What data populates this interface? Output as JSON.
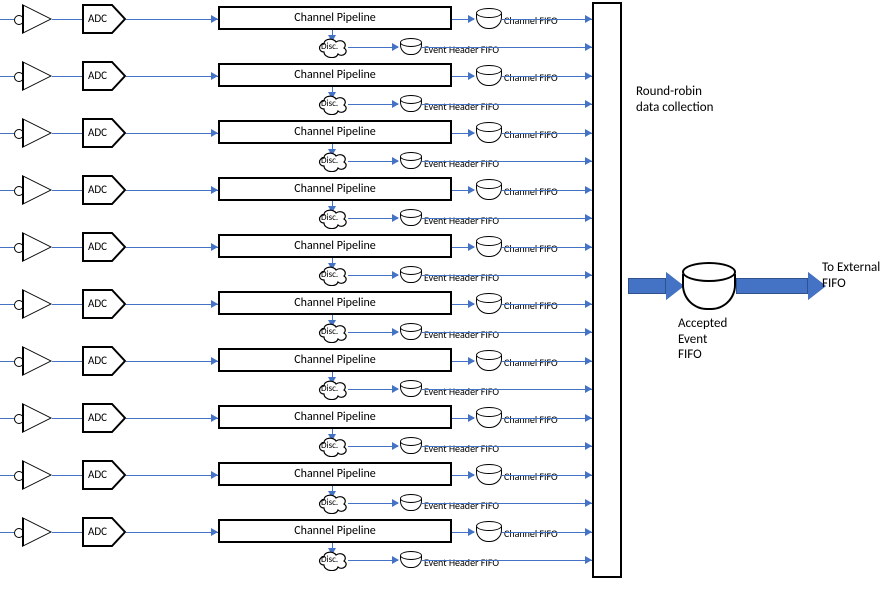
{
  "channels": [
    {
      "adc": "ADC",
      "pipeline": "Channel Pipeline",
      "channel_fifo": "Channel FIFO",
      "disc": "Disc.",
      "event_header_fifo": "Event Header FIFO"
    },
    {
      "adc": "ADC",
      "pipeline": "Channel Pipeline",
      "channel_fifo": "Channel FIFO",
      "disc": "Disc.",
      "event_header_fifo": "Event Header FIFO"
    },
    {
      "adc": "ADC",
      "pipeline": "Channel Pipeline",
      "channel_fifo": "Channel FIFO",
      "disc": "Disc.",
      "event_header_fifo": "Event Header FIFO"
    },
    {
      "adc": "ADC",
      "pipeline": "Channel Pipeline",
      "channel_fifo": "Channel FIFO",
      "disc": "Disc.",
      "event_header_fifo": "Event Header FIFO"
    },
    {
      "adc": "ADC",
      "pipeline": "Channel Pipeline",
      "channel_fifo": "Channel FIFO",
      "disc": "Disc.",
      "event_header_fifo": "Event Header FIFO"
    },
    {
      "adc": "ADC",
      "pipeline": "Channel Pipeline",
      "channel_fifo": "Channel FIFO",
      "disc": "Disc.",
      "event_header_fifo": "Event Header FIFO"
    },
    {
      "adc": "ADC",
      "pipeline": "Channel Pipeline",
      "channel_fifo": "Channel FIFO",
      "disc": "Disc.",
      "event_header_fifo": "Event Header FIFO"
    },
    {
      "adc": "ADC",
      "pipeline": "Channel Pipeline",
      "channel_fifo": "Channel FIFO",
      "disc": "Disc.",
      "event_header_fifo": "Event Header FIFO"
    },
    {
      "adc": "ADC",
      "pipeline": "Channel Pipeline",
      "channel_fifo": "Channel FIFO",
      "disc": "Disc.",
      "event_header_fifo": "Event Header FIFO"
    },
    {
      "adc": "ADC",
      "pipeline": "Channel Pipeline",
      "channel_fifo": "Channel FIFO",
      "disc": "Disc.",
      "event_header_fifo": "Event Header FIFO"
    }
  ],
  "round_robin": {
    "label_l1": "Round-robin",
    "label_l2": "data collection"
  },
  "accepted": {
    "l1": "Accepted",
    "l2": "Event",
    "l3": "FIFO"
  },
  "external": {
    "l1": "To External",
    "l2": "FIFO"
  }
}
